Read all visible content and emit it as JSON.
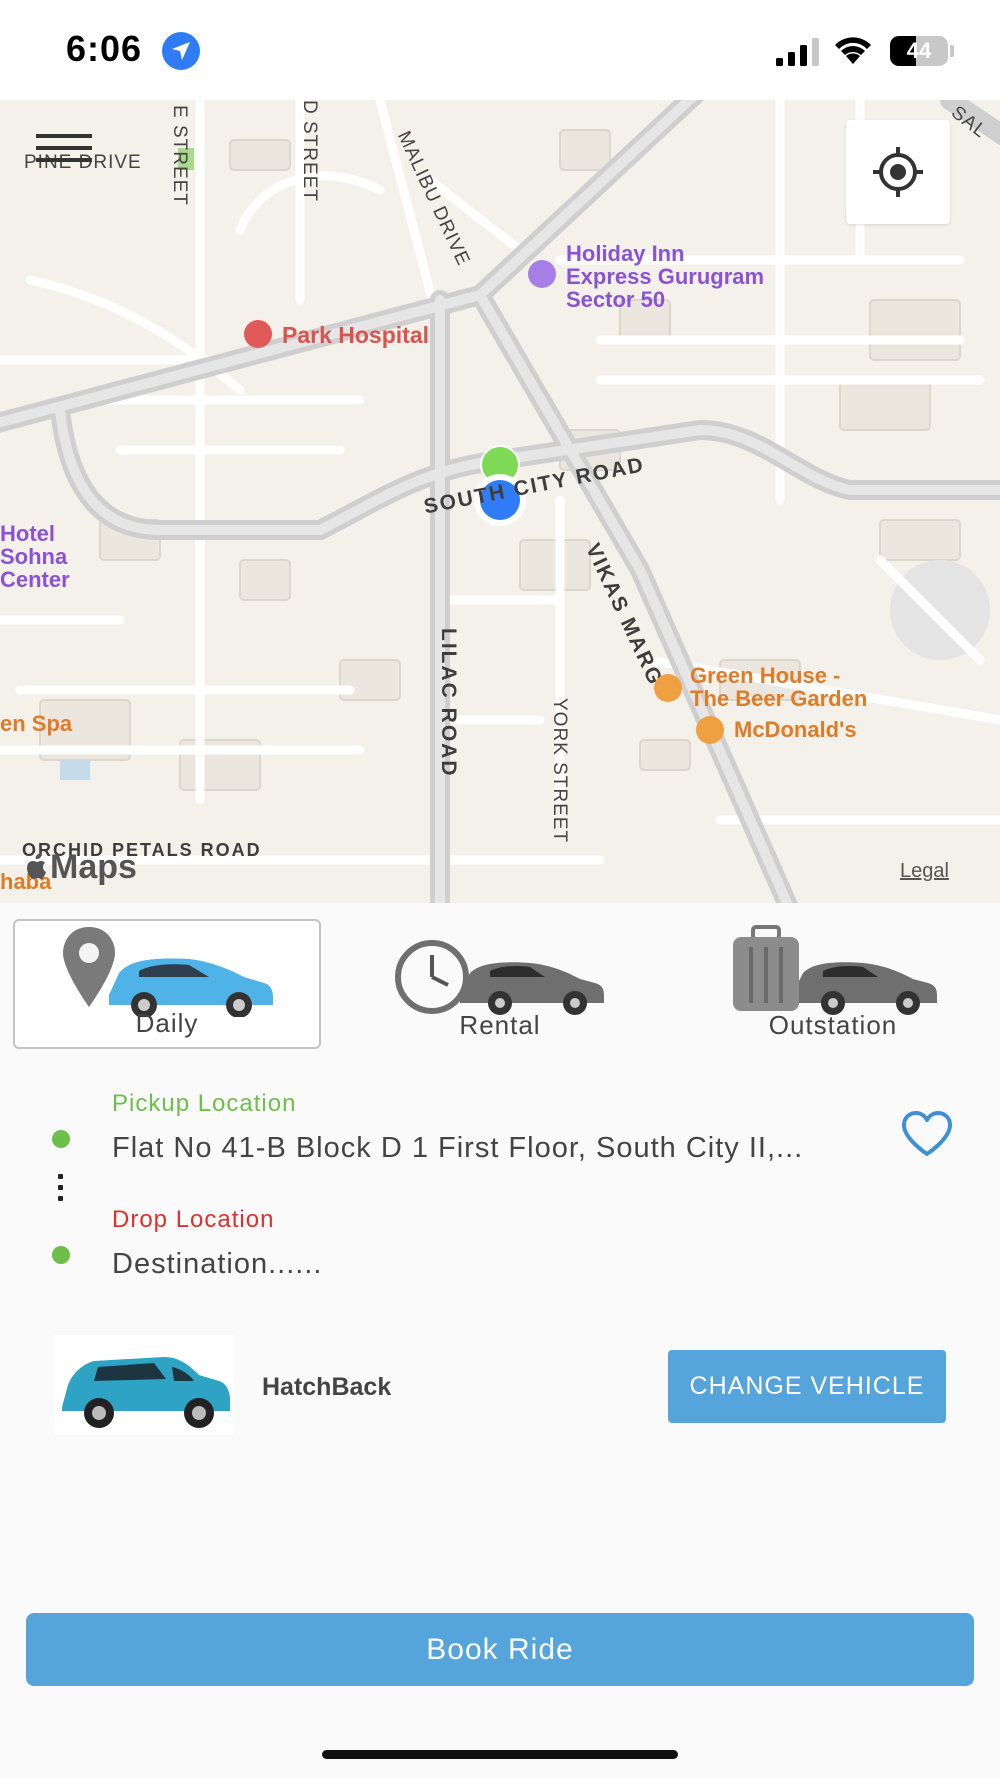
{
  "status_bar": {
    "time": "6:06",
    "battery_level": "44",
    "battery_fraction": 0.44
  },
  "map": {
    "street_labels": {
      "pine_drive": "PINE DRIVE",
      "e_street": "E STREET",
      "d_street": "D STREET",
      "malibu_drive": "MALIBU DRIVE",
      "south_city_road": "SOUTH CITY ROAD",
      "vikas_marg": "VIKAS MARG",
      "lilac_road": "LILAC ROAD",
      "york_street": "YORK STREET",
      "orchid_petals_road": "ORCHID PETALS ROAD",
      "edge_top_right": "SAL"
    },
    "pois": {
      "holiday_inn": "Holiday Inn\nExpress Gurugram\nSector 50",
      "park_hospital": "Park Hospital",
      "hotel_sohna": "Hotel\nSohna\nCenter",
      "green_house": "Green House -\nThe Beer Garden",
      "mcdonalds": "McDonald's",
      "en_spa": "en Spa",
      "haba": "haba"
    },
    "attribution": {
      "maps_logo": "Maps",
      "legal": "Legal"
    },
    "colors": {
      "land": "#f4f1ea",
      "road": "#ffffff",
      "major_road": "#cfcfcf",
      "pin_green": "#7ed957",
      "pin_blue": "#2f7cf6"
    }
  },
  "ride_types": [
    {
      "label": "Daily",
      "icon": "location-pin-car-icon",
      "active": true
    },
    {
      "label": "Rental",
      "icon": "clock-car-icon",
      "active": false
    },
    {
      "label": "Outstation",
      "icon": "luggage-car-icon",
      "active": false
    }
  ],
  "locations": {
    "pickup_label": "Pickup Location",
    "pickup_value": "Flat No 41-B Block D 1 First Floor, South City II,...",
    "drop_label": "Drop Location",
    "drop_value": "Destination......",
    "favorite_icon": "heart-outline-icon",
    "colors": {
      "pickup": "#6cc04a",
      "drop": "#e0302b"
    }
  },
  "vehicle": {
    "name": "HatchBack",
    "change_label": "CHANGE VEHICLE"
  },
  "book_ride": {
    "label": "Book Ride"
  },
  "accent_color": "#55a4dc"
}
